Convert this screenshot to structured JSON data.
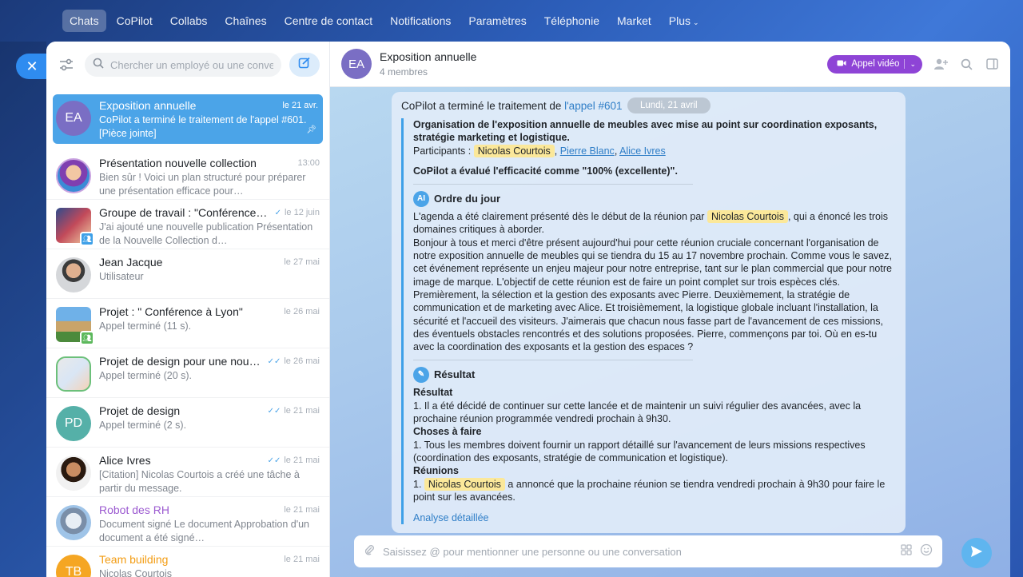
{
  "nav": {
    "items": [
      "Chats",
      "CoPilot",
      "Collabs",
      "Chaînes",
      "Centre de contact",
      "Notifications",
      "Paramètres",
      "Téléphonie",
      "Market",
      "Plus"
    ],
    "active": "Chats"
  },
  "sidebar": {
    "search_placeholder": "Chercher un employé ou une conversation",
    "chats": [
      {
        "avatar_text": "EA",
        "title": "Exposition annuelle",
        "date": "le 21 avr.",
        "preview": "CoPilot a terminé le traitement de l'appel #601. [Pièce jointe]"
      },
      {
        "avatar_text": "",
        "title": "Présentation nouvelle collection",
        "date": "13:00",
        "preview": "Bien sûr ! Voici un plan structuré pour préparer une présentation efficace pour…"
      },
      {
        "avatar_text": "",
        "title": "Groupe de travail : \"Conférence…",
        "date": "le 12 juin",
        "preview": "J'ai ajouté une nouvelle publication Présentation de la Nouvelle Collection d…"
      },
      {
        "avatar_text": "",
        "title": "Jean Jacque",
        "date": "le 27 mai",
        "preview": "Utilisateur"
      },
      {
        "avatar_text": "",
        "title": "Projet : \" Conférence à Lyon\"",
        "date": "le 26 mai",
        "preview": "Appel terminé (11 s)."
      },
      {
        "avatar_text": "",
        "title": "Projet de design pour une nou…",
        "date": "le 26 mai",
        "preview": "Appel terminé (20 s)."
      },
      {
        "avatar_text": "PD",
        "title": "Projet de design",
        "date": "le 21 mai",
        "preview": "Appel terminé (2 s)."
      },
      {
        "avatar_text": "",
        "title": "Alice Ivres",
        "date": "le 21 mai",
        "preview": "[Citation] Nicolas Courtois a créé une tâche à partir du message."
      },
      {
        "avatar_text": "",
        "title": "Robot des RH",
        "date": "le 21 mai",
        "preview": "Document signé Le document Approbation d'un document a été signé…"
      },
      {
        "avatar_text": "TB",
        "title": "Team building",
        "date": "le 21 mai",
        "preview": "Nicolas Courtois"
      }
    ]
  },
  "header": {
    "avatar_text": "EA",
    "title": "Exposition annuelle",
    "subtitle": "4 membres",
    "video_label": "Appel vidéo"
  },
  "message": {
    "date_chip": "Lundi, 21 avril",
    "head_text": "CoPilot a terminé le traitement de ",
    "head_link": "l'appel #601",
    "summary_title": "Organisation de l'exposition annuelle de meubles avec mise au point sur coordination exposants, stratégie marketing et logistique.",
    "participants_label": "Participants :",
    "participant1": "Nicolas Courtois",
    "participant2": "Pierre Blanc",
    "participant3": "Alice Ivres",
    "efficiency": "CoPilot a évalué l'efficacité comme \"100% (excellente)\".",
    "agenda_title": "Ordre du jour",
    "agenda_pre": "L'agenda a été clairement présenté dès le début de la réunion par",
    "agenda_mention": "Nicolas Courtois",
    "agenda_post": ", qui a énoncé les trois domaines critiques à aborder.",
    "agenda_body": "Bonjour à tous et merci d'être présent aujourd'hui pour cette réunion cruciale concernant l'organisation de notre exposition annuelle de meubles qui se tiendra du 15 au 17 novembre prochain. Comme vous le savez, cet événement représente un enjeu majeur pour notre entreprise, tant sur le plan commercial que pour notre image de marque. L'objectif de cette réunion est de faire un point complet sur trois espèces clés. Premièrement, la sélection et la gestion des exposants avec Pierre. Deuxièmement, la stratégie de communication et de marketing avec Alice. Et troisièmement, la logistique globale incluant l'installation, la sécurité et l'accueil des visiteurs. J'aimerais que chacun nous fasse part de l'avancement de ces missions, des éventuels obstacles rencontrés et des solutions proposées. Pierre, commençons par toi. Où en es-tu avec la coordination des exposants et la gestion des espaces ?",
    "result_title": "Résultat",
    "result_sub": "Résultat",
    "result_body": "1. Il a été décidé de continuer sur cette lancée et de maintenir un suivi régulier des avancées, avec la prochaine réunion programmée vendredi prochain à 9h30.",
    "todo_title": "Choses à faire",
    "todo_body": "1. Tous les membres doivent fournir un rapport détaillé sur l'avancement de leurs missions respectives (coordination des exposants, stratégie de communication et logistique).",
    "meet_title": "Réunions",
    "meet_pre": "1.",
    "meet_mention": "Nicolas Courtois",
    "meet_post": "a annoncé que la prochaine réunion se tiendra vendredi prochain à 9h30 pour faire le point sur les avancées.",
    "detail_link": "Analyse détaillée"
  },
  "composer": {
    "placeholder": "Saisissez @ pour mentionner une personne ou une conversation"
  },
  "colors": {
    "accent": "#4ba4e8",
    "video": "#8e44d6",
    "mention": "#fbe89a"
  }
}
